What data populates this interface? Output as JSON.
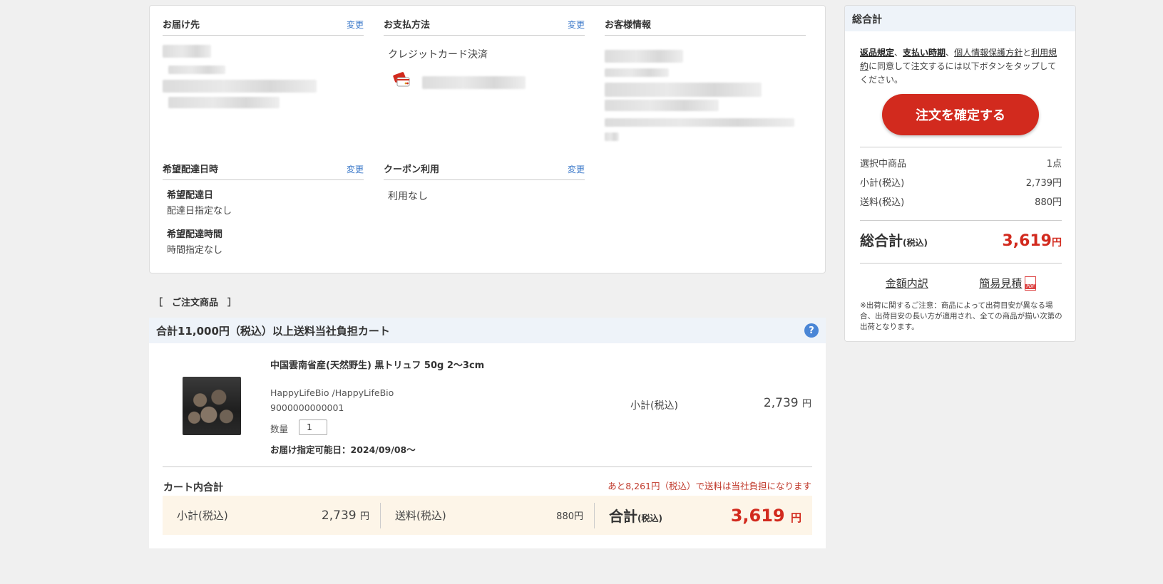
{
  "info": {
    "delivery": {
      "title": "お届け先",
      "change": "変更"
    },
    "payment": {
      "title": "お支払方法",
      "change": "変更",
      "method": "クレジットカード決済"
    },
    "customer": {
      "title": "お客様情報"
    },
    "date_pref": {
      "title": "希望配達日時",
      "change": "変更",
      "date_label": "希望配達日",
      "date_value": "配達日指定なし",
      "time_label": "希望配達時間",
      "time_value": "時間指定なし"
    },
    "coupon": {
      "title": "クーポン利用",
      "change": "変更",
      "value": "利用なし"
    }
  },
  "summary": {
    "title": "総合計",
    "agree": {
      "t1": "返品規定",
      "sep1": "、",
      "t2": "支払い時期",
      "sep2": "、",
      "t3": "個人情報保護方針",
      "sep3": "と",
      "t4": "利用規約",
      "rest": "に同意して注文するには以下ボタンをタップしてください。"
    },
    "confirm": "注文を確定する",
    "rows": [
      {
        "label": "選択中商品",
        "value": "1点"
      },
      {
        "label": "小計(税込)",
        "value": "2,739円"
      },
      {
        "label": "送料(税込)",
        "value": "880円"
      }
    ],
    "total_label": "総合計",
    "total_tax": "(税込)",
    "total_amount": "3,619",
    "yen": "円",
    "link_breakdown": "金額内訳",
    "link_estimate": "簡易見積",
    "note": "※出荷に関するご注意：商品によって出荷目安が異なる場合、出荷目安の長い方が適用され、全ての商品が揃い次第の出荷となります。"
  },
  "order_label": "［　ご注文商品　］",
  "cart": {
    "title": "合計11,000円（税込）以上送料当社負担カート",
    "help": "?",
    "product": {
      "name": "中国雲南省産(天然野生) 黒トリュフ 50g 2〜3cm",
      "shop": "HappyLifeBio /HappyLifeBio",
      "code": "9000000000001",
      "qty_label": "数量",
      "qty": "1",
      "date": "お届け指定可能日：2024/09/08〜",
      "sub_label": "小計(税込)",
      "sub_amount": "2,739",
      "yen": "円"
    },
    "total_title": "カート内合計",
    "free_msg": "あと8,261円（税込）で送料は当社負担になります",
    "bar": {
      "sub_label": "小計(税込)",
      "sub_value": "2,739",
      "yen": "円",
      "ship_label": "送料(税込)",
      "ship_value": "880円",
      "grand_label": "合計",
      "grand_tax": "(税込)",
      "grand_value": "3,619"
    }
  }
}
